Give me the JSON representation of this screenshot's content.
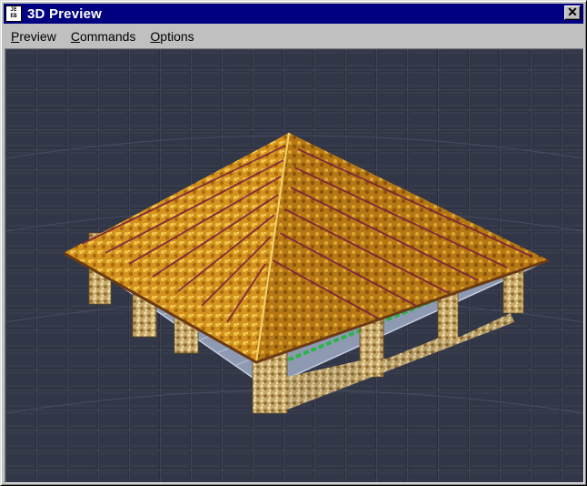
{
  "window": {
    "title": "3D Preview",
    "close_symbol": "✕",
    "app_icon": "jeb-app-icon",
    "title_bar_color": "#000080"
  },
  "menubar": {
    "items": [
      {
        "key": "P",
        "rest": "review"
      },
      {
        "key": "C",
        "rest": "ommands"
      },
      {
        "key": "O",
        "rest": "ptions"
      }
    ]
  },
  "viewport": {
    "scene": "3d-house-preview",
    "background_color": "#2b2f3d",
    "roof_color": "#d4931e",
    "wall_color": "#c8a868",
    "floor_color": "#8e9ab2"
  }
}
